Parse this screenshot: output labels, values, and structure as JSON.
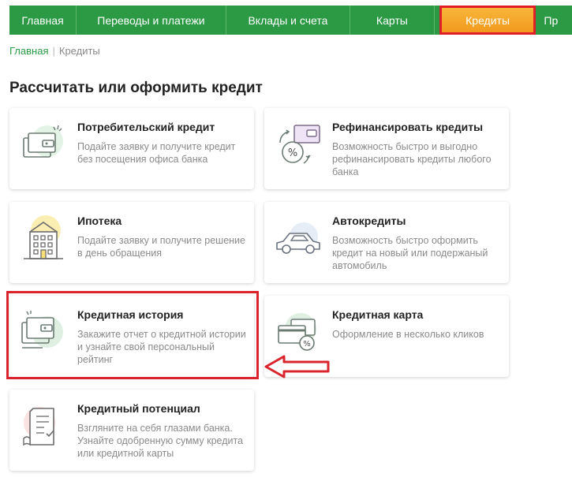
{
  "nav": {
    "items": [
      {
        "label": "Главная"
      },
      {
        "label": "Переводы и платежи"
      },
      {
        "label": "Вклады и счета"
      },
      {
        "label": "Карты"
      },
      {
        "label": "Кредиты",
        "active": true
      },
      {
        "label": "Пр"
      }
    ]
  },
  "breadcrumb": {
    "home": "Главная",
    "current": "Кредиты",
    "separator": "|"
  },
  "heading": "Рассчитать или оформить кредит",
  "cards": [
    {
      "title": "Потребительский кредит",
      "desc": "Подайте заявку и получите кредит без посещения офиса банка",
      "icon": "wallet-icon"
    },
    {
      "title": "Рефинансировать кредиты",
      "desc": "Возможность быстро и выгодно рефинансировать кредиты любого банка",
      "icon": "refinance-percent-icon"
    },
    {
      "title": "Ипотека",
      "desc": "Подайте заявку и получите решение в день обращения",
      "icon": "building-icon"
    },
    {
      "title": "Автокредиты",
      "desc": "Возможность быстро оформить кредит на новый или подержаный автомобиль",
      "icon": "car-icon"
    },
    {
      "title": "Кредитная история",
      "desc": "Закажите отчет о кредитной истории и узнайте свой персональный рейтинг",
      "icon": "credit-report-icon"
    },
    {
      "title": "Кредитная карта",
      "desc": "Оформление в несколько кликов",
      "icon": "credit-card-icon"
    },
    {
      "title": "Кредитный потенциал",
      "desc": "Взгляните на себя глазами банка. Узнайте одобренную сумму кредита или кредитной карты",
      "icon": "document-check-icon"
    }
  ],
  "colors": {
    "brand_green": "#2c9a45",
    "active_orange": "#f29a1e",
    "highlight_red": "#d9232d"
  }
}
